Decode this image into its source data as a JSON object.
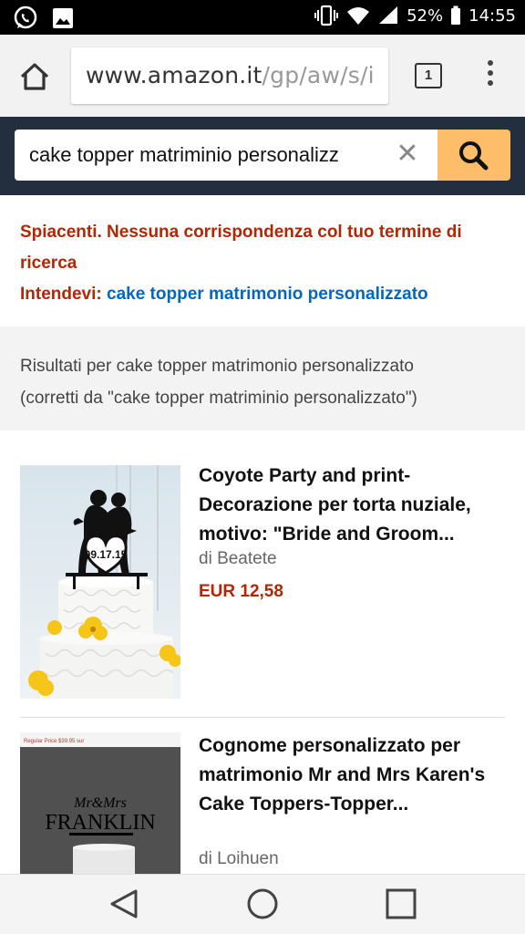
{
  "status_bar": {
    "battery": "52%",
    "time": "14:55",
    "icons": [
      "whatsapp-icon",
      "gallery-icon",
      "vibrate-icon",
      "wifi-icon",
      "signal-icon",
      "battery-icon"
    ]
  },
  "browser": {
    "url_host": "www.amazon.it",
    "url_path": "/gp/aw/s/i",
    "tab_count": "1"
  },
  "search": {
    "query": "cake topper matriminio personalizz",
    "clear_symbol": "✕"
  },
  "notice": {
    "sorry": "Spiacenti. Nessuna corrispondenza col tuo termine di ricerca",
    "meant_label": "Intendevi:",
    "meant_link": "cake topper matrimonio personalizzato"
  },
  "results_info": {
    "line1": "Risultati per cake topper matrimonio personalizzato",
    "line2": "(corretti da \"cake topper matriminio personalizzato\")"
  },
  "results": [
    {
      "title": "Coyote Party and print-Decorazione per torta nuziale, motivo: \"Bride and Groom...",
      "by": "di Beatete",
      "price": "EUR 12,58",
      "thumb_date": "09.17.15"
    },
    {
      "title": "Cognome personalizzato per matrimonio Mr and Mrs Karen's Cake Toppers-Topper...",
      "by": "di Loihuen",
      "thumb_banner": "Regular Price $39.95 sur",
      "thumb_top": "Mr&Mrs",
      "thumb_name": "FRANKLIN"
    }
  ],
  "colors": {
    "amazon_band": "#232f3e",
    "search_button": "#febd69",
    "price": "#b12704",
    "link": "#0066c0"
  }
}
